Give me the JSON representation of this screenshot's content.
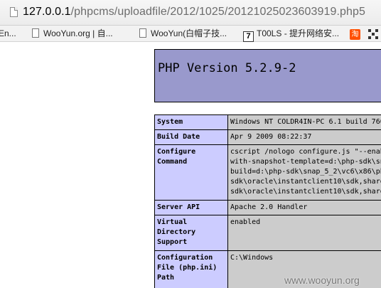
{
  "browser": {
    "url_host": "127.0.0.1",
    "url_path": "/phpcms/uploadfile/2012/1025/20121025023603919.php5"
  },
  "bookmarks": [
    {
      "label": "En..."
    },
    {
      "label": "WooYun.org | 自..."
    },
    {
      "label": "WooYun(白帽子技..."
    },
    {
      "label": "T00LS - 提升网络安..."
    },
    {
      "label": "淘"
    }
  ],
  "phpinfo": {
    "title": "PHP Version 5.2.9-2",
    "rows": [
      {
        "key": "System",
        "value": [
          "Windows NT COLDR4IN-PC 6.1 build 760"
        ]
      },
      {
        "key": "Build Date",
        "value": [
          "Apr 9 2009 08:22:37"
        ]
      },
      {
        "key": "Configure Command",
        "value": [
          "cscript /nologo configure.js \"--enab",
          "with-snapshot-template=d:\\php-sdk\\sn",
          "build=d:\\php-sdk\\snap_5_2\\vc6\\x86\\ph",
          "sdk\\oracle\\instantclient10\\sdk,share",
          "sdk\\oracle\\instantclient10\\sdk,share"
        ]
      },
      {
        "key": "Server API",
        "value": [
          "Apache 2.0 Handler"
        ]
      },
      {
        "key": "Virtual Directory Support",
        "value": [
          "enabled"
        ]
      },
      {
        "key": "Configuration File (php.ini) Path",
        "value": [
          "C:\\Windows"
        ]
      }
    ]
  },
  "watermark": "www.wooyun.org"
}
